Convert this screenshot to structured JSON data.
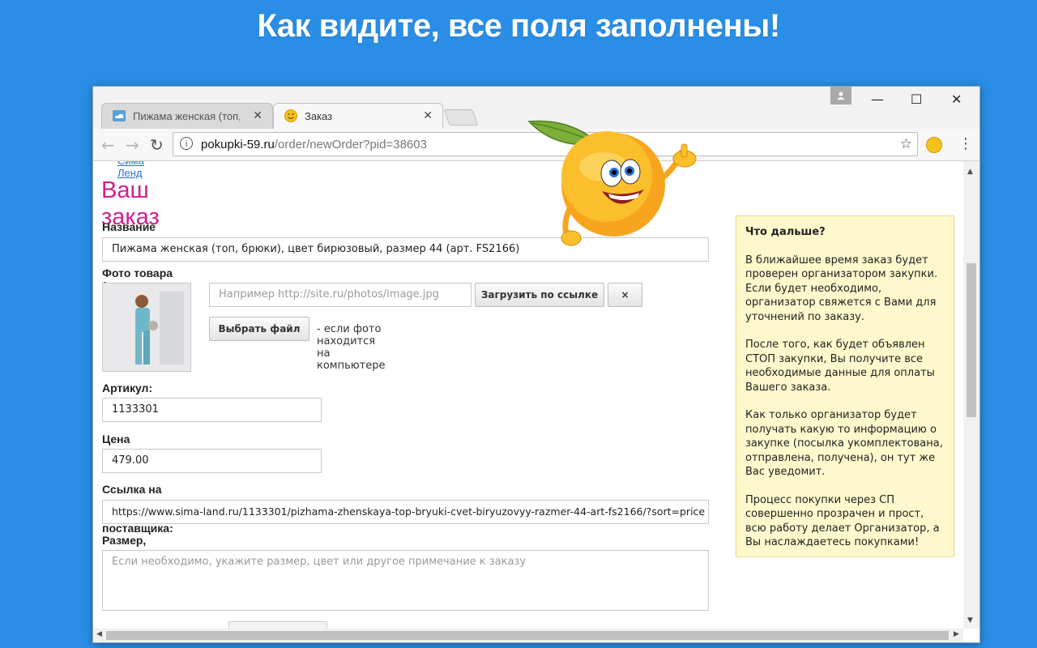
{
  "headline": "Как видите, все поля заполнены!",
  "browser": {
    "tabs": [
      {
        "label": "Пижама женская (топ, б",
        "icon": "cloud-icon",
        "active": false
      },
      {
        "label": "Заказ",
        "icon": "smiley-icon",
        "active": true
      }
    ],
    "url_host": "pokupki-59.ru",
    "url_path": "/order/newOrder?pid=38603",
    "colors": {
      "window_bg": "#2a8ee6",
      "title_accent": "#cf1f8f",
      "info_box_bg": "#fff8cc"
    }
  },
  "page": {
    "crumb": "Сима Ленд",
    "title": "Ваш заказ",
    "fields": {
      "name_label": "Название товара:",
      "name_value": "Пижама женская (топ, брюки), цвет бирюзовый, размер 44 (арт. FS2166)",
      "photo_label": "Фото товара (при наличии указывается обязательно):",
      "photo_url_placeholder": "Например http://site.ru/photos/image.jpg",
      "load_by_link": "Загрузить по ссылке",
      "clear_symbol": "×",
      "choose_file": "Выбрать файл",
      "choose_file_hint": "- если фото находится на компьютере",
      "sku_label": "Артикул:",
      "sku_value": "1133301",
      "price_label": "Цена товара, руб.:",
      "price_value": "479.00",
      "link_label": "Ссылка на товар на сайте поставщика:",
      "link_value": "https://www.sima-land.ru/1133301/pizhama-zhenskaya-top-bryuki-cvet-biryuzovyy-razmer-44-art-fs2166/?sort=price",
      "note_label": "Размер, цвет или другое примечание к заказу:",
      "note_placeholder": "Если необходимо, укажите размер, цвет или другое примечание к заказу"
    },
    "sidebar": {
      "title": "Что дальше?",
      "paragraphs": [
        "В ближайшее время заказ будет проверен организатором закупки. Если будет необходимо, организатор свяжется с Вами для уточнений по заказу.",
        "После того, как будет объявлен СТОП закупки, Вы получите все необходимые данные для оплаты Вашего заказа.",
        "Как только организатор будет получать какую то информацию о закупке (посылка укомплектована, отправлена, получена), он тут же Вас уведомит.",
        "Процесс покупки через СП совершенно прозрачен и прост, всю работу делает Организатор, а Вы наслаждаетесь покупками!"
      ]
    }
  }
}
